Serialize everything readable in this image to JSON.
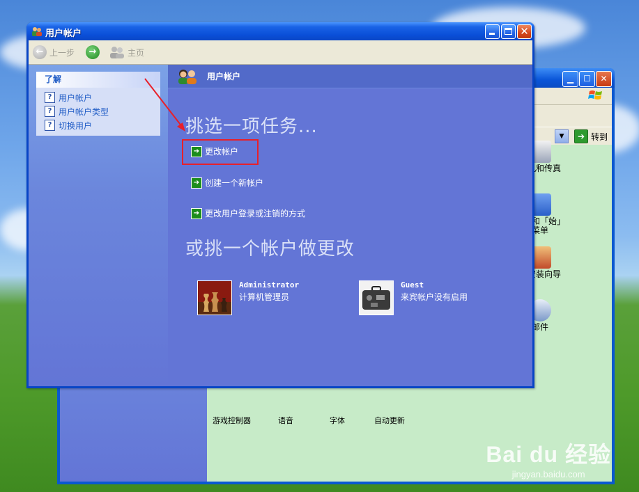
{
  "main_window": {
    "title": "用户帐户",
    "toolbar": {
      "back_label": "上一步",
      "home_label": "主页"
    },
    "learn_box": {
      "header": "了解",
      "items": [
        "用户帐户",
        "用户帐户类型",
        "切换用户"
      ]
    },
    "header_title": "用户帐户",
    "task_heading": "挑选一项任务...",
    "tasks": [
      "更改帐户",
      "创建一个新帐户",
      "更改用户登录或注销的方式"
    ],
    "account_heading": "或挑一个帐户做更改",
    "accounts": [
      {
        "name": "Administrator",
        "desc": "计算机管理员"
      },
      {
        "name": "Guest",
        "desc": "来宾帐户没有启用"
      }
    ]
  },
  "background_window": {
    "goto_label": "转到",
    "items": [
      "印机和传真",
      "务栏和「始」菜单",
      "络安装向导",
      "邮件"
    ],
    "bottom_labels": [
      "游戏控制器",
      "语音",
      "字体",
      "自动更新"
    ]
  },
  "watermark": {
    "logo": "Bai du 经验",
    "url": "jingyan.baidu.com"
  },
  "colors": {
    "xp_blue": "#0845c6",
    "pane_blue": "#6375d6",
    "highlight_red": "#e8202a",
    "link_blue": "#215dc6"
  }
}
